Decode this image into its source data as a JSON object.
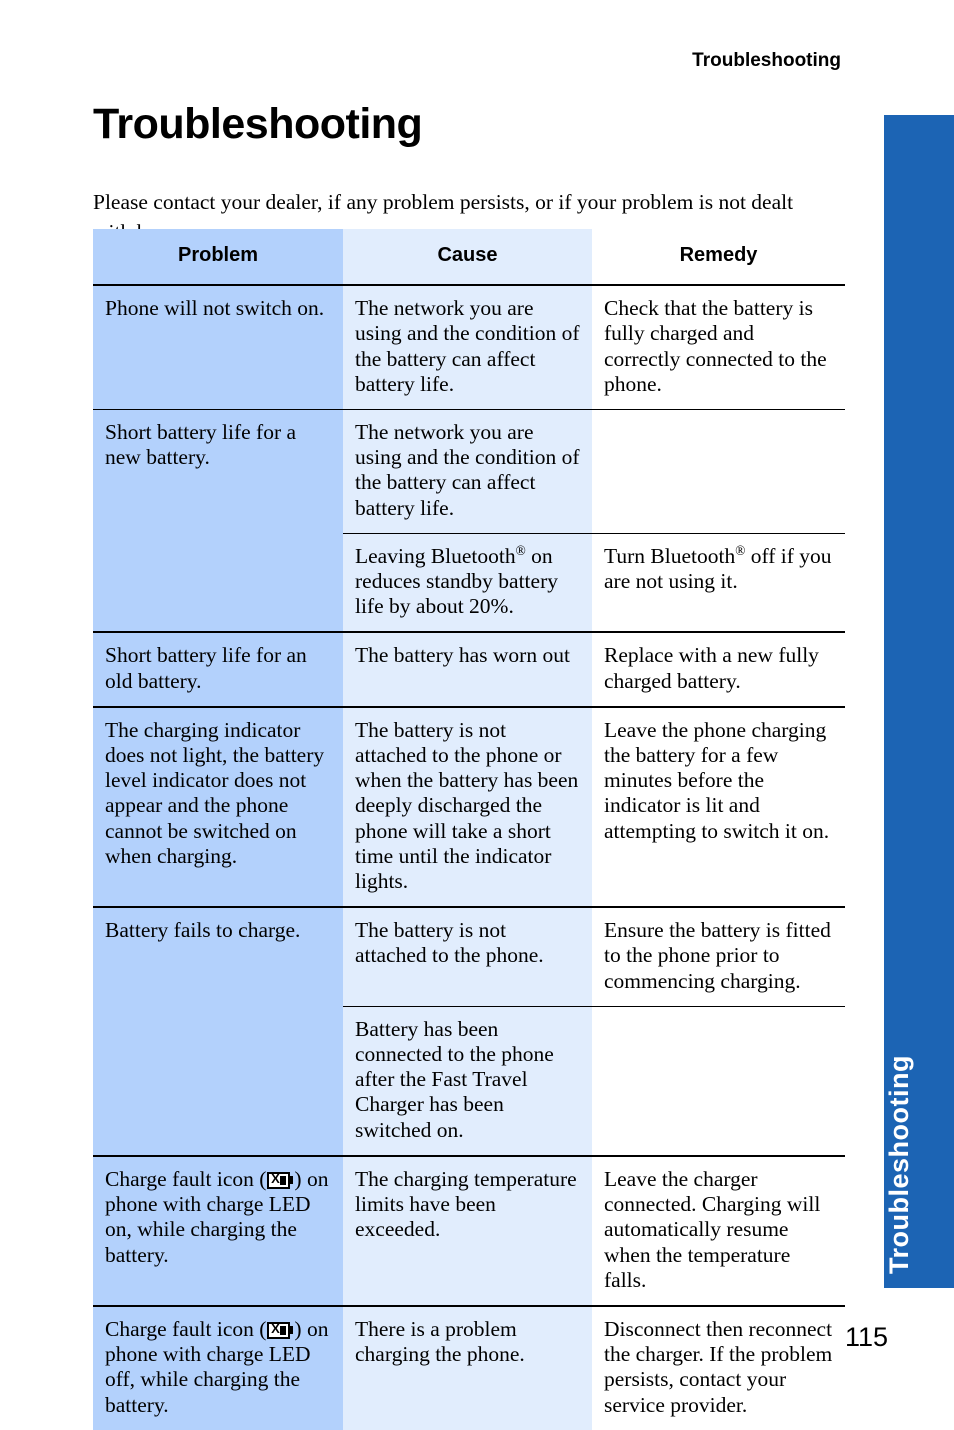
{
  "document": {
    "running_head": "Troubleshooting",
    "title": "Troubleshooting",
    "intro": "Please contact your dealer, if any problem persists, or if your problem is not dealt with here.",
    "page_number": "115",
    "thumb_tab_label": "Troubleshooting",
    "colors": {
      "tab_blue": "#1c64b4",
      "problem_column": "#b3d1fc",
      "cause_column": "#e1edfd",
      "remedy_column": "#ffffff"
    }
  },
  "table": {
    "headers": {
      "problem": "Problem",
      "cause": "Cause",
      "remedy": "Remedy"
    },
    "rows": [
      {
        "problem": "Phone will not switch on.",
        "cause": "The network you are using and the condition of the battery can affect battery life.",
        "remedy": "Check that the battery is fully charged and correctly connected to the phone."
      },
      {
        "problem": "Short battery life for a new battery.",
        "cause": "The network you are using and the condition of the battery can affect battery life.",
        "remedy": ""
      },
      {
        "problem": "",
        "cause_prefix": "Leaving Bluetooth",
        "cause_suffix": " on reduces standby battery life by about 20%.",
        "remedy_prefix": "Turn Bluetooth",
        "remedy_suffix": " off if you are not using it.",
        "registered_mark": "®"
      },
      {
        "problem": "Short battery life for an old battery.",
        "cause": "The battery has worn out",
        "remedy": "Replace with a new fully charged battery."
      },
      {
        "problem": "The charging indicator does not light, the battery level indicator does not appear and the phone cannot be switched on when charging.",
        "cause": "The battery is not attached to the phone or when the battery has been deeply discharged the phone will take a short time until the indicator lights.",
        "remedy": "Leave the phone charging the battery for a few minutes before the indicator is lit and attempting to switch it on."
      },
      {
        "problem": "Battery fails to charge.",
        "cause": "The battery is not attached to the phone.",
        "remedy": "Ensure the battery is fitted to the phone prior to commencing charging."
      },
      {
        "problem": "",
        "cause": "Battery has been connected to the phone after the Fast Travel Charger has been switched on.",
        "remedy": ""
      },
      {
        "problem_prefix": "Charge fault icon (",
        "problem_suffix": ") on phone with charge LED on, while charging the battery.",
        "problem_icon": "charge-fault-battery-icon",
        "cause": "The charging temperature limits have been exceeded.",
        "remedy": "Leave the charger connected. Charging will automatically resume when the temperature falls."
      },
      {
        "problem_prefix": "Charge fault icon (",
        "problem_suffix": ") on phone with charge LED off, while charging the battery.",
        "problem_icon": "charge-fault-battery-icon",
        "cause": "There is a problem charging the phone.",
        "remedy": "Disconnect then reconnect the charger. If the problem persists, contact your service provider."
      }
    ]
  }
}
